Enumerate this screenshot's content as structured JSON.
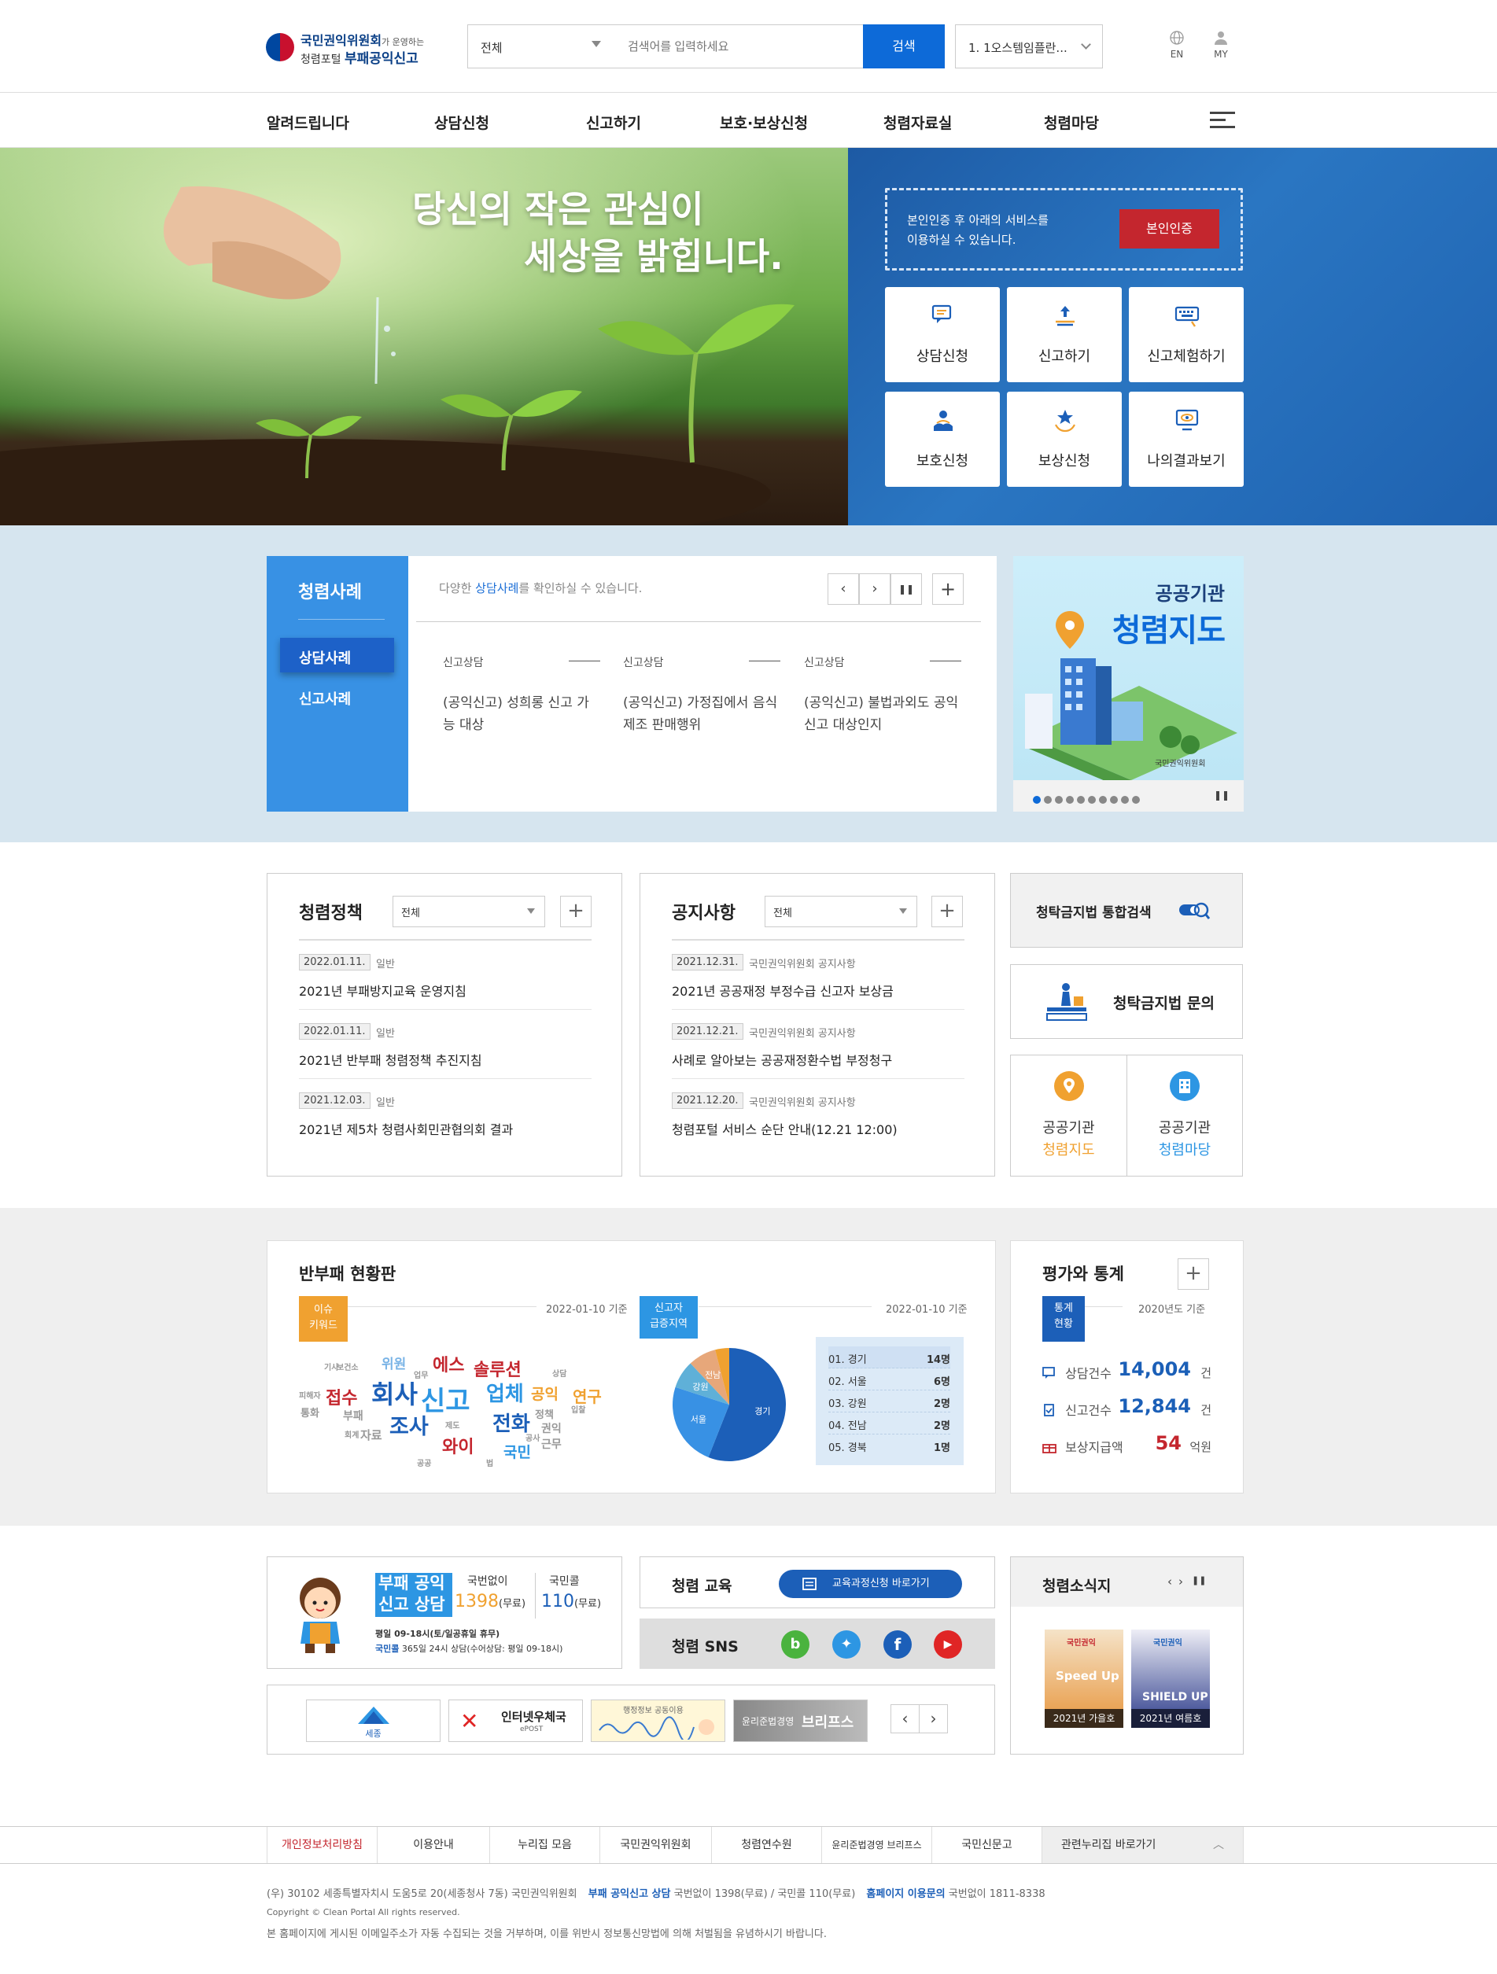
{
  "header": {
    "logo_line1": "국민권익위원회",
    "logo_line1_small": "가 운영하는",
    "logo_line2a": "청렴포털",
    "logo_line2b": "부패공익신고",
    "search_scope": "전체",
    "search_placeholder": "검색어를 입력하세요",
    "search_button": "검색",
    "keyword_select": "1. 1오스템임플란...",
    "lang": "EN",
    "my": "MY"
  },
  "gnb": [
    "알려드립니다",
    "상담신청",
    "신고하기",
    "보호·보상신청",
    "청렴자료실",
    "청렴마당"
  ],
  "hero": {
    "title1": "당신의 작은 관심이",
    "title2": "세상을 밝힙니다.",
    "cert_text1": "본인인증 후 아래의 서비스를",
    "cert_text2": "이용하실 수 있습니다.",
    "cert_button": "본인인증",
    "services": [
      "상담신청",
      "신고하기",
      "신고체험하기",
      "보호신청",
      "보상신청",
      "나의결과보기"
    ]
  },
  "cases": {
    "title": "청렴사례",
    "tabs": [
      "상담사례",
      "신고사례"
    ],
    "desc_pre": "다양한 ",
    "desc_hl": "상담사례",
    "desc_post": "를 확인하실 수 있습니다.",
    "items": [
      {
        "cat": "신고상담",
        "body": "(공익신고) 성희롱 신고 가능 대상"
      },
      {
        "cat": "신고상담",
        "body": "(공익신고) 가정집에서 음식제조 판매행위"
      },
      {
        "cat": "신고상담",
        "body": "(공익신고) 불법과외도 공익신고 대상인지"
      }
    ],
    "map_sub": "공공기관",
    "map_title": "청렴지도",
    "map_org": "국민권익위원회"
  },
  "policy": {
    "title": "청렴정책",
    "select": "전체",
    "items": [
      {
        "date": "2022.01.11.",
        "cat": "일반",
        "title": "2021년 부패방지교육 운영지침"
      },
      {
        "date": "2022.01.11.",
        "cat": "일반",
        "title": "2021년 반부패 청렴정책 추진지침"
      },
      {
        "date": "2021.12.03.",
        "cat": "일반",
        "title": "2021년 제5차 청렴사회민관협의회 결과"
      }
    ]
  },
  "notice": {
    "title": "공지사항",
    "select": "전체",
    "items": [
      {
        "date": "2021.12.31.",
        "cat": "국민권익위원회 공지사항",
        "title": "2021년 공공재정 부정수급 신고자 보상금"
      },
      {
        "date": "2021.12.21.",
        "cat": "국민권익위원회 공지사항",
        "title": "사례로 알아보는 공공재정환수법 부정청구"
      },
      {
        "date": "2021.12.20.",
        "cat": "국민권익위원회 공지사항",
        "title": "청렴포털 서비스 순단 안내(12.21 12:00)"
      }
    ]
  },
  "side": {
    "search": "청탁금지법 통합검색",
    "inquiry": "청탁금지법 문의",
    "map1": "공공기관",
    "map2": "청렴지도",
    "yard1": "공공기관",
    "yard2": "청렴마당"
  },
  "status": {
    "title": "반부패 현황판",
    "issue1": "이슈",
    "issue2": "키워드",
    "std1": "2022-01-10 기준",
    "region1": "신고자",
    "region2": "급증지역",
    "std2": "2022-01-10 기준",
    "words": [
      "위원",
      "에스",
      "솔루션",
      "접수",
      "회사",
      "신고",
      "업체",
      "공익",
      "연구",
      "조사",
      "전화",
      "와이",
      "국민",
      "부패",
      "자료",
      "통화",
      "정책",
      "권익",
      "근무",
      "상담",
      "보건소",
      "업무",
      "제도",
      "공사",
      "회계",
      "피해자",
      "기사",
      "공공",
      "법",
      "입찰"
    ],
    "ranking": [
      {
        "label": "01. 경기",
        "count": "14명"
      },
      {
        "label": "02. 서울",
        "count": "6명"
      },
      {
        "label": "03. 강원",
        "count": "2명"
      },
      {
        "label": "04. 전남",
        "count": "2명"
      },
      {
        "label": "05. 경북",
        "count": "1명"
      }
    ],
    "pie_labels": [
      "경기",
      "서울",
      "강원",
      "전남",
      "경북"
    ]
  },
  "chart_data": {
    "type": "pie",
    "categories": [
      "경기",
      "서울",
      "강원",
      "전남",
      "경북"
    ],
    "values": [
      14,
      6,
      2,
      2,
      1
    ]
  },
  "stats": {
    "title": "평가와 통계",
    "badge1": "통계",
    "badge2": "현황",
    "std": "2020년도 기준",
    "rows": [
      {
        "label": "상담건수",
        "num": "14,004",
        "unit": "건"
      },
      {
        "label": "신고건수",
        "num": "12,844",
        "unit": "건"
      },
      {
        "label": "보상지급액",
        "num": "54",
        "unit": "억원"
      }
    ]
  },
  "contact": {
    "char_line1": "부패 공익",
    "char_line2": "신고 상담",
    "t1": "국번없이",
    "n1": "1398",
    "u1": "(무료)",
    "t2": "국민콜",
    "n2": "110",
    "u2": "(무료)",
    "hours": "평일 09-18시(토/일공휴일 휴무)",
    "call_hl": "국민콜",
    "call": " 365일 24시 상담(수어상담: 평일 09-18시)"
  },
  "edu": {
    "title": "청렴 교육",
    "button": "교육과정신청 바로가기",
    "sns": "청렴 SNS"
  },
  "news": {
    "title": "청렴소식지",
    "items": [
      "2021년 가을호",
      "2021년 여름호"
    ],
    "cover1": "Speed Up",
    "cover2": "SHIELD UP",
    "pub": "국민권익"
  },
  "banners": [
    "세종특별자치시",
    "인터넷우체국",
    "행정정보 공동이용",
    "윤리준법경영 브리프스"
  ],
  "banner_texts": {
    "b1": "세종",
    "b2a": "인터넷우체국",
    "b2b": "ePOST",
    "b3": "행정정보 공동이용",
    "b4": "브리프스",
    "b4s": "윤리준법경영"
  },
  "footer": {
    "nav": [
      "개인정보처리방침",
      "이용안내",
      "누리집 모음",
      "국민권익위원회",
      "청렴연수원",
      "윤리준법경영 브리프스",
      "국민신문고",
      "관련누리집 바로가기"
    ],
    "addr": "(우) 30102 세종특별자치시 도움5로 20(세종청사 7동) 국민권익위원회",
    "tel1_hl": "부패 공익신고 상담",
    "tel1": "국번없이 1398(무료) / 국민콜 110(무료)",
    "tel2_hl": "홈페이지 이용문의",
    "tel2": "국번없이 1811-8338",
    "copy": "Copyright © Clean Portal All rights reserved.",
    "notice": "본 홈페이지에 게시된 이메일주소가 자동 수집되는 것을 거부하며, 이를 위반시 정보통신망법에 의해 처벌됨을 유념하시기 바랍니다."
  }
}
